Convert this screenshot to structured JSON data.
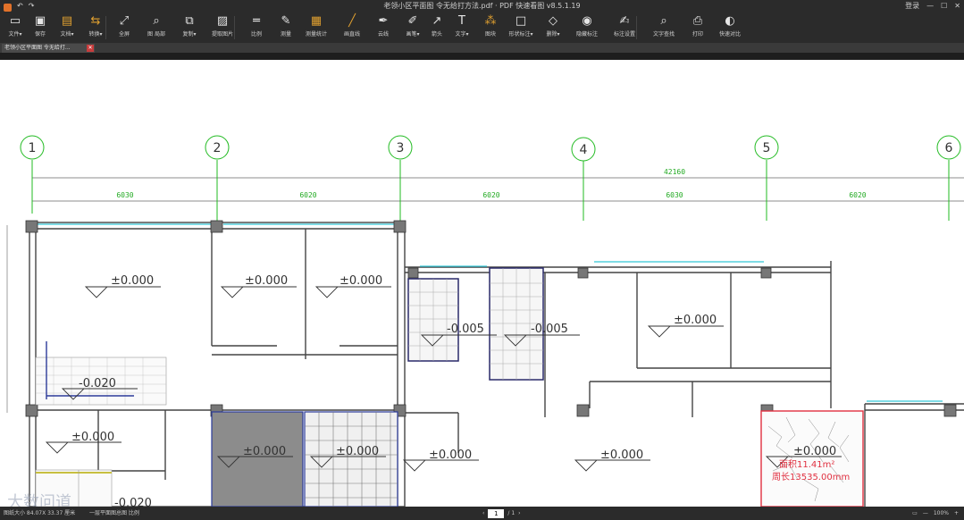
{
  "app": {
    "title": "老领小区平面图 令无给打方法.pdf · PDF 快速看图 v8.5.1.19",
    "login": "登录",
    "window_controls": [
      "—",
      "☐",
      "✕"
    ]
  },
  "toolbar": {
    "items": [
      {
        "label": "文件▾",
        "icon": "folder-icon"
      },
      {
        "label": "保存",
        "icon": "save-icon"
      },
      {
        "label": "文档▾",
        "icon": "document-icon"
      },
      {
        "label": "转换▾",
        "icon": "convert-icon"
      },
      {
        "label": "全屏",
        "icon": "fullscreen-icon"
      },
      {
        "label": "图 局部",
        "icon": "zoom-area-icon"
      },
      {
        "label": "复制▾",
        "icon": "copy-icon"
      },
      {
        "label": "提取图片",
        "icon": "extract-image-icon"
      },
      {
        "label": "比例",
        "icon": "ruler-icon"
      },
      {
        "label": "测量",
        "icon": "measure-icon"
      },
      {
        "label": "测量统计",
        "icon": "stats-icon"
      },
      {
        "label": "画直线",
        "icon": "line-icon"
      },
      {
        "label": "云线",
        "icon": "pen-icon"
      },
      {
        "label": "画笔▾",
        "icon": "brush-icon"
      },
      {
        "label": "箭头",
        "icon": "arrow-icon"
      },
      {
        "label": "文字▾",
        "icon": "text-icon"
      },
      {
        "label": "图块",
        "icon": "blocks-icon"
      },
      {
        "label": "形状标注▾",
        "icon": "shape-icon"
      },
      {
        "label": "删除▾",
        "icon": "eraser-icon"
      },
      {
        "label": "隐藏标注",
        "icon": "eye-icon"
      },
      {
        "label": "标注设置",
        "icon": "settings-pen-icon"
      },
      {
        "label": "文字查找",
        "icon": "search-icon"
      },
      {
        "label": "打印",
        "icon": "print-icon"
      },
      {
        "label": "快速对比",
        "icon": "compare-icon"
      }
    ]
  },
  "tab": {
    "label": "老领小区平面图 令无给打...",
    "close": "✕"
  },
  "drawing": {
    "axes": [
      "1",
      "2",
      "3",
      "4",
      "5",
      "6"
    ],
    "total_dim": "42160",
    "bay_dims": [
      "6030",
      "6020",
      "6020",
      "6030",
      "6020"
    ],
    "levels": [
      "±0.000",
      "±0.000",
      "±0.000",
      "-0.005",
      "-0.005",
      "±0.000",
      "-0.020",
      "±0.000",
      "±0.000",
      "±0.000",
      "±0.000",
      "±0.000",
      "±0.000",
      "-0.020"
    ],
    "red_note_1": "面积11.41m²",
    "red_note_2": "周长13535.00mm"
  },
  "status": {
    "left": "图纸大小 84.07X 33.37 厘米",
    "left2": "一层平面图总图 比例",
    "page_current": "1",
    "page_total": "/ 1",
    "zoom": "100%",
    "zoom_minus": "—",
    "zoom_plus": "+"
  },
  "watermark": "大数问道"
}
